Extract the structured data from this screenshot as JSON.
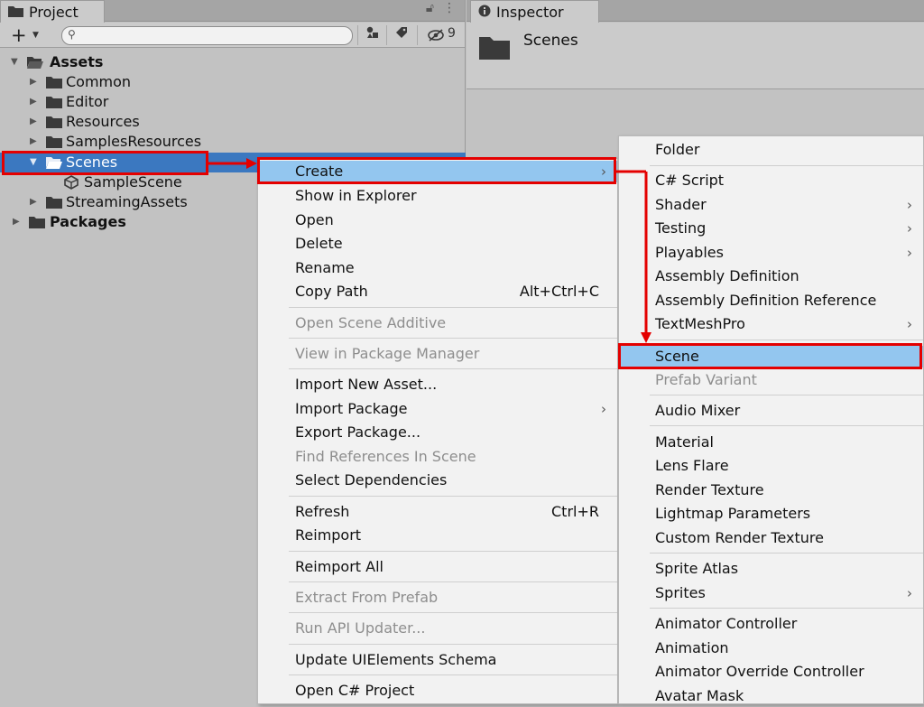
{
  "project": {
    "tab_label": "Project",
    "hidden_count": "9",
    "tree": [
      {
        "label": "Assets",
        "expanded": true,
        "bold": true
      },
      {
        "label": "Common"
      },
      {
        "label": "Editor"
      },
      {
        "label": "Resources"
      },
      {
        "label": "SamplesResources"
      },
      {
        "label": "Scenes",
        "expanded": true,
        "selected": true
      },
      {
        "label": "SampleScene"
      },
      {
        "label": "StreamingAssets"
      },
      {
        "label": "Packages",
        "bold": true
      }
    ]
  },
  "inspector": {
    "tab_label": "Inspector",
    "title": "Scenes"
  },
  "context_menu": {
    "items": [
      {
        "label": "Create",
        "submenu": true,
        "highlighted": true
      },
      {
        "label": "Show in Explorer"
      },
      {
        "label": "Open"
      },
      {
        "label": "Delete"
      },
      {
        "label": "Rename"
      },
      {
        "label": "Copy Path",
        "shortcut": "Alt+Ctrl+C"
      },
      {
        "label": "Open Scene Additive",
        "disabled": true
      },
      {
        "label": "View in Package Manager",
        "disabled": true
      },
      {
        "label": "Import New Asset..."
      },
      {
        "label": "Import Package",
        "submenu": true
      },
      {
        "label": "Export Package..."
      },
      {
        "label": "Find References In Scene",
        "disabled": true
      },
      {
        "label": "Select Dependencies"
      },
      {
        "label": "Refresh",
        "shortcut": "Ctrl+R"
      },
      {
        "label": "Reimport"
      },
      {
        "label": "Reimport All"
      },
      {
        "label": "Extract From Prefab",
        "disabled": true
      },
      {
        "label": "Run API Updater...",
        "disabled": true
      },
      {
        "label": "Update UIElements Schema"
      },
      {
        "label": "Open C# Project"
      }
    ]
  },
  "create_submenu": {
    "items": [
      {
        "label": "Folder"
      },
      {
        "label": "C# Script"
      },
      {
        "label": "Shader",
        "submenu": true
      },
      {
        "label": "Testing",
        "submenu": true
      },
      {
        "label": "Playables",
        "submenu": true
      },
      {
        "label": "Assembly Definition"
      },
      {
        "label": "Assembly Definition Reference"
      },
      {
        "label": "TextMeshPro",
        "submenu": true
      },
      {
        "label": "Scene",
        "highlighted": true
      },
      {
        "label": "Prefab Variant",
        "disabled": true
      },
      {
        "label": "Audio Mixer"
      },
      {
        "label": "Material"
      },
      {
        "label": "Lens Flare"
      },
      {
        "label": "Render Texture"
      },
      {
        "label": "Lightmap Parameters"
      },
      {
        "label": "Custom Render Texture"
      },
      {
        "label": "Sprite Atlas"
      },
      {
        "label": "Sprites",
        "submenu": true
      },
      {
        "label": "Animator Controller"
      },
      {
        "label": "Animation"
      },
      {
        "label": "Animator Override Controller"
      },
      {
        "label": "Avatar Mask"
      }
    ]
  },
  "colors": {
    "selection": "#3b78c0",
    "menu_highlight": "#93c6ef",
    "annotation_red": "#e40000"
  }
}
